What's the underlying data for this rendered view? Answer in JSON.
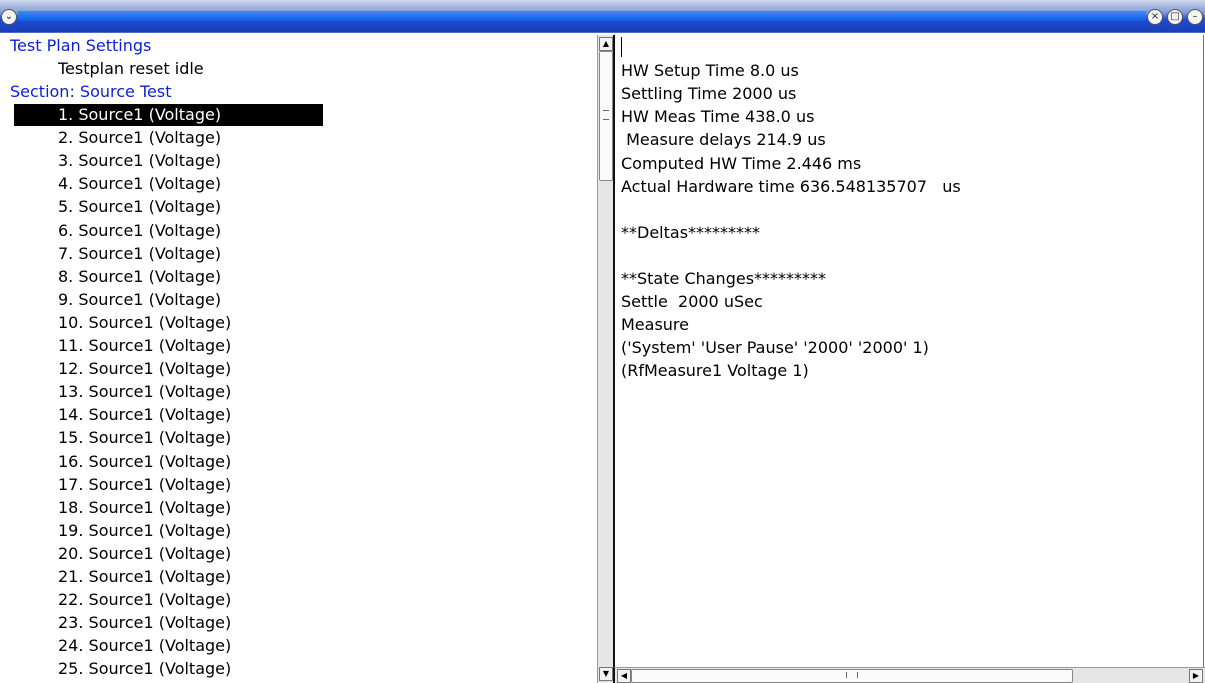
{
  "window": {
    "title_icons": {
      "menu": "chevron-down-icon",
      "close": "close-icon",
      "maximize": "maximize-icon",
      "minimize": "minimize-icon"
    }
  },
  "left": {
    "plan_header": "Test Plan Settings",
    "plan_item": "Testplan reset idle",
    "section_header": "Section: Source Test",
    "selected_index": 0,
    "items": [
      "1. Source1 (Voltage)",
      "2. Source1 (Voltage)",
      "3. Source1 (Voltage)",
      "4. Source1 (Voltage)",
      "5. Source1 (Voltage)",
      "6. Source1 (Voltage)",
      "7. Source1 (Voltage)",
      "8. Source1 (Voltage)",
      "9. Source1 (Voltage)",
      "10. Source1 (Voltage)",
      "11. Source1 (Voltage)",
      "12. Source1 (Voltage)",
      "13. Source1 (Voltage)",
      "14. Source1 (Voltage)",
      "15. Source1 (Voltage)",
      "16. Source1 (Voltage)",
      "17. Source1 (Voltage)",
      "18. Source1 (Voltage)",
      "19. Source1 (Voltage)",
      "20. Source1 (Voltage)",
      "21. Source1 (Voltage)",
      "22. Source1 (Voltage)",
      "23. Source1 (Voltage)",
      "24. Source1 (Voltage)",
      "25. Source1 (Voltage)"
    ]
  },
  "right": {
    "lines": [
      "",
      "HW Setup Time 8.0 us",
      "Settling Time 2000 us",
      "HW Meas Time 438.0 us",
      " Measure delays 214.9 us",
      "Computed HW Time 2.446 ms",
      "Actual Hardware time 636.548135707   us",
      "",
      "**Deltas*********",
      "",
      "**State Changes*********",
      "Settle  2000 uSec",
      "Measure",
      "('System' 'User Pause' '2000' '2000' 1)",
      "(RfMeasure1 Voltage 1)"
    ]
  }
}
